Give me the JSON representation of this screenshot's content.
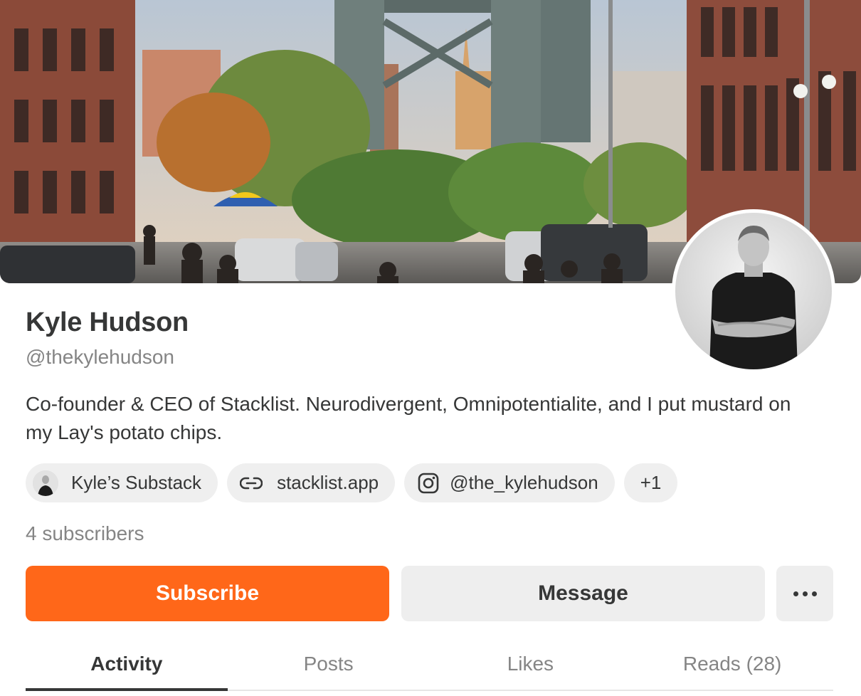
{
  "profile": {
    "name": "Kyle Hudson",
    "handle": "@thekylehudson",
    "bio": "Co-founder & CEO of Stacklist. Neurodivergent, Omnipotentialite, and I put mustard on my Lay's potato chips.",
    "subscribers": "4 subscribers"
  },
  "links": {
    "substack": {
      "label": "Kyle’s Substack",
      "icon": "avatar"
    },
    "website": {
      "label": "stacklist.app",
      "icon": "link-icon"
    },
    "instagram": {
      "label": "@the_kylehudson",
      "icon": "instagram-icon"
    },
    "more": {
      "label": "+1"
    }
  },
  "actions": {
    "subscribe_label": "Subscribe",
    "message_label": "Message",
    "more_icon": "ellipsis-icon"
  },
  "tabs": [
    {
      "label": "Activity",
      "active": true
    },
    {
      "label": "Posts",
      "active": false
    },
    {
      "label": "Likes",
      "active": false
    },
    {
      "label": "Reads (28)",
      "active": false
    }
  ],
  "colors": {
    "accent": "#ff6719",
    "text": "#363737",
    "muted": "#858585",
    "chip_bg": "#efefef"
  }
}
